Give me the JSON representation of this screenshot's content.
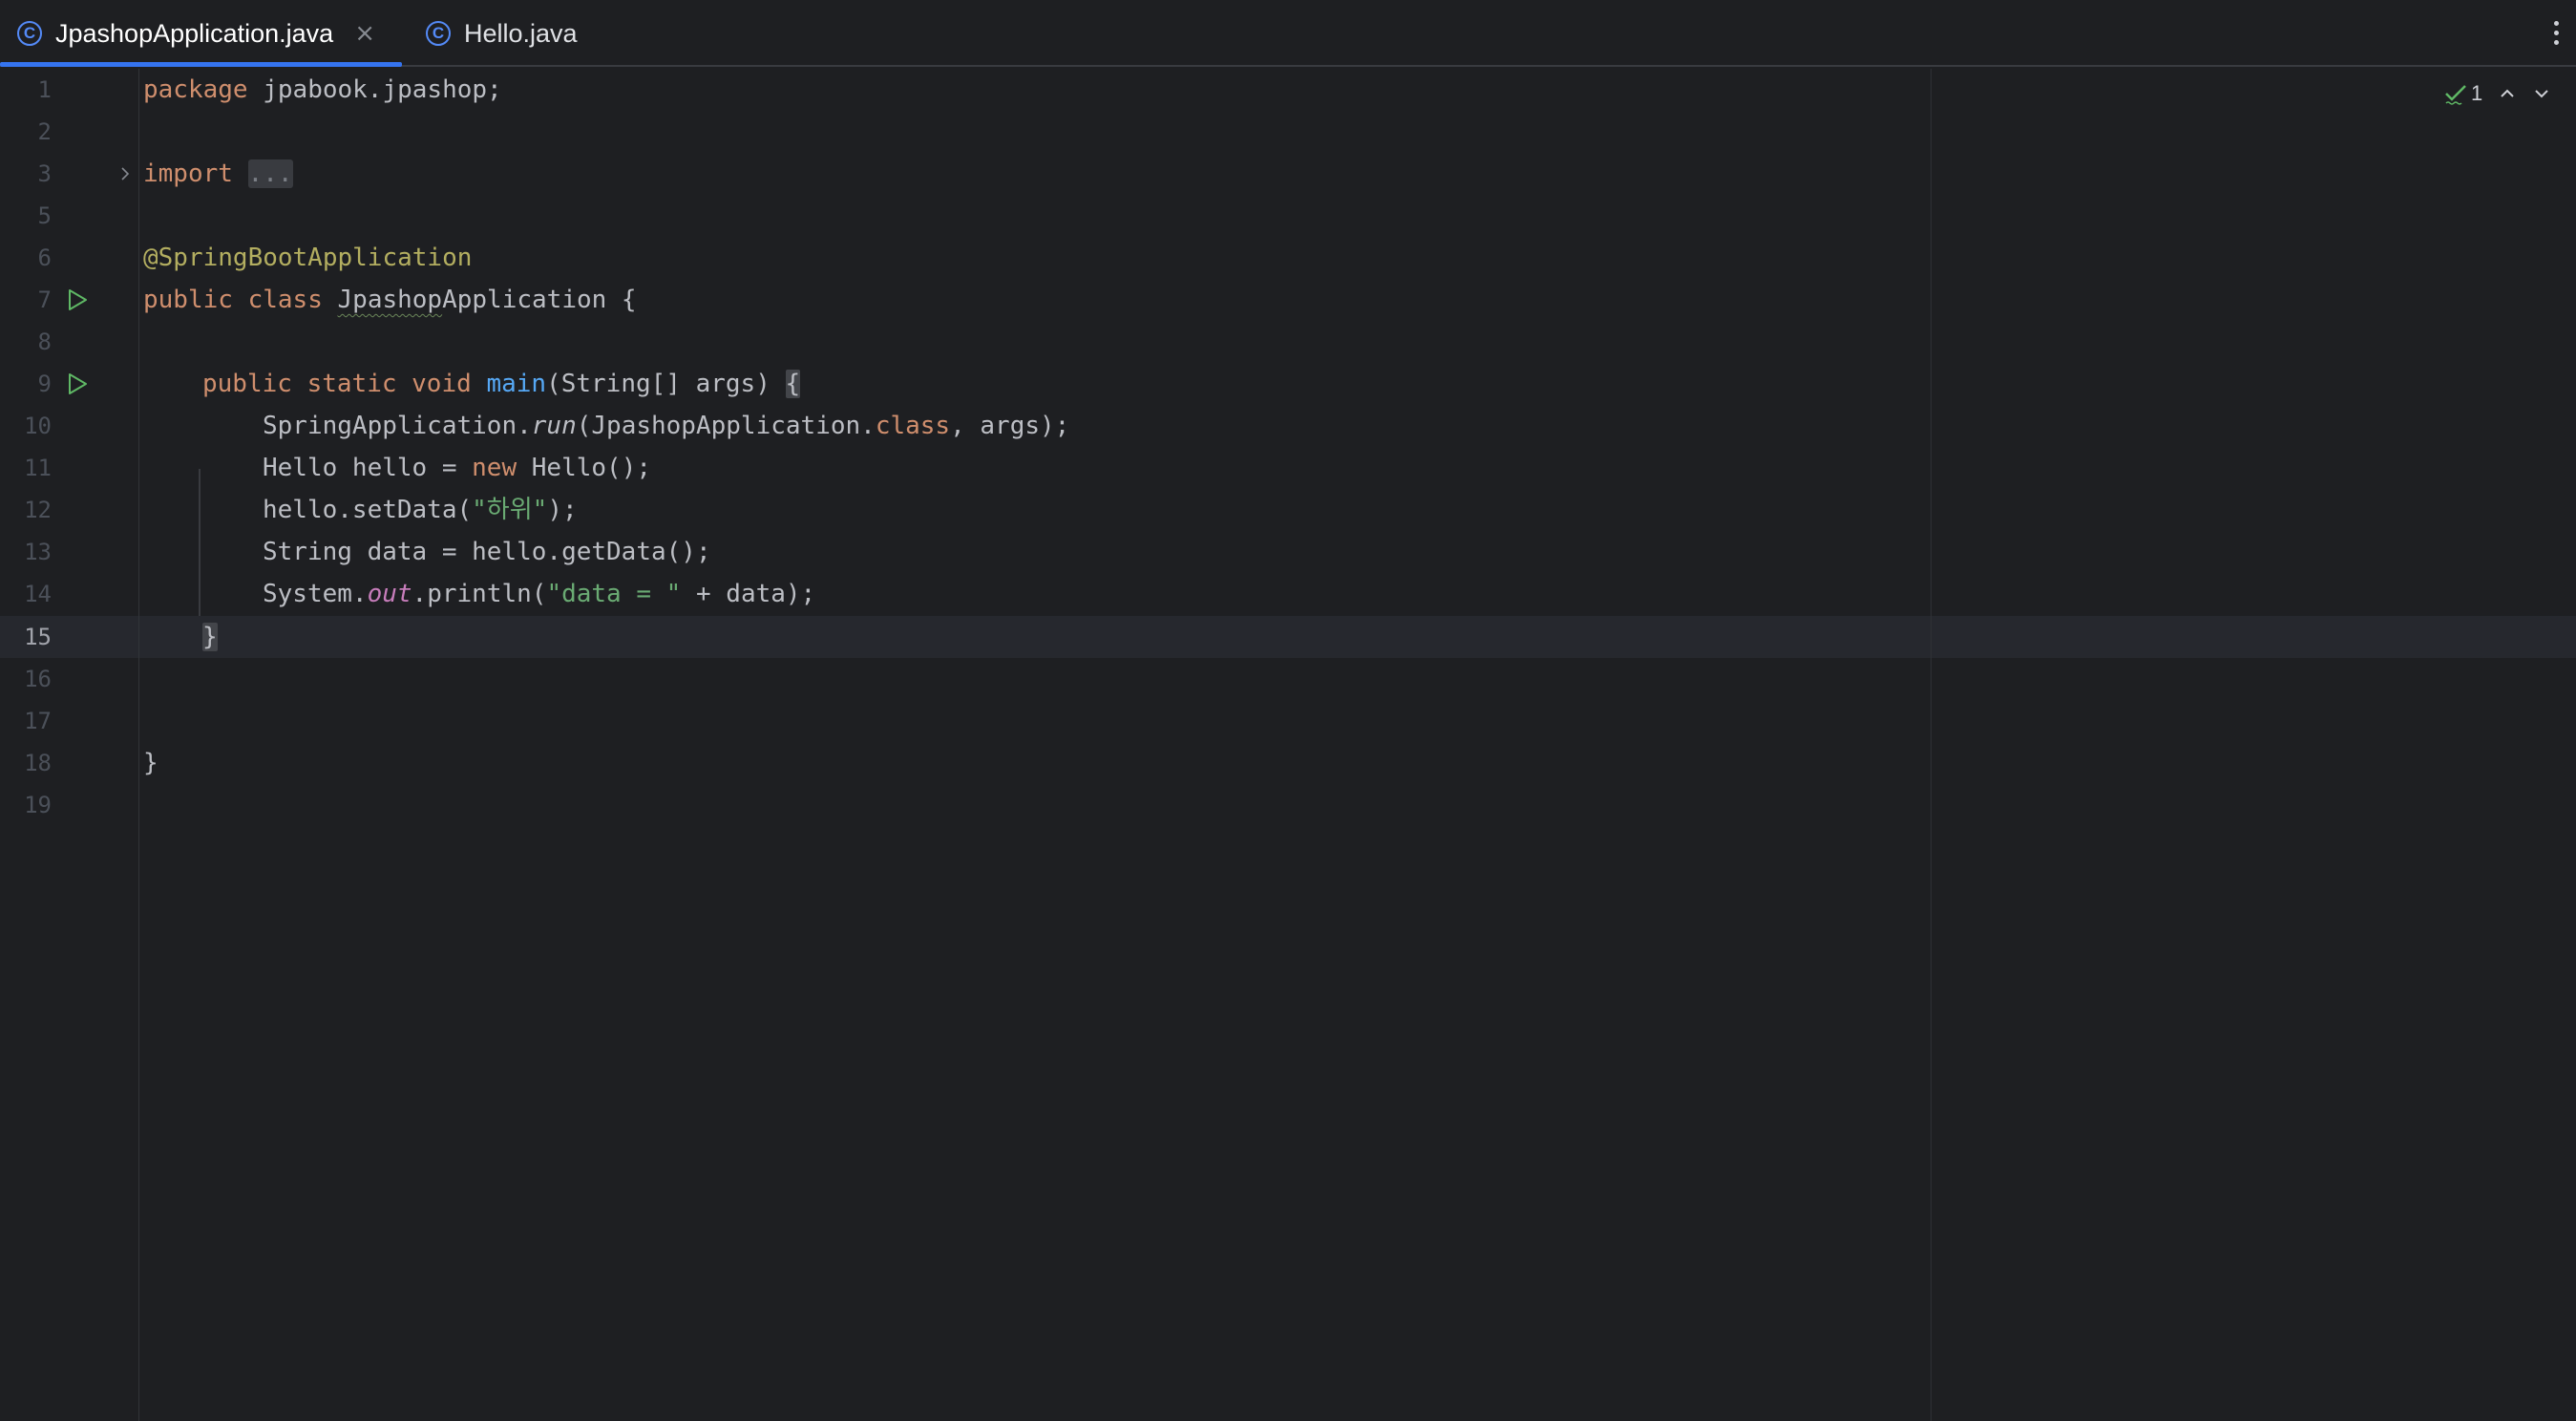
{
  "tabs": [
    {
      "label": "JpashopApplication.java",
      "icon": "class-icon",
      "active": true,
      "close": "×"
    },
    {
      "label": "Hello.java",
      "icon": "class-icon",
      "active": false
    }
  ],
  "class_icon_letter": "C",
  "inspections": {
    "count": "1"
  },
  "lines": {
    "n1": "1",
    "n2": "2",
    "n3": "3",
    "n5": "5",
    "n6": "6",
    "n7": "7",
    "n8": "8",
    "n9": "9",
    "n10": "10",
    "n11": "11",
    "n12": "12",
    "n13": "13",
    "n14": "14",
    "n15": "15",
    "n16": "16",
    "n17": "17",
    "n18": "18",
    "n19": "19"
  },
  "code": {
    "l1_kw": "package",
    "l1_rest": " jpabook.jpashop;",
    "l3_kw": "import",
    "l3_fold": "...",
    "l6_ann": "@SpringBootApplication",
    "l7_kw1": "public",
    "l7_kw2": "class",
    "l7_cls_a": "Jpashop",
    "l7_cls_b": "Application",
    "l7_rest": " {",
    "l9_kw1": "public",
    "l9_kw2": "static",
    "l9_kw3": "void",
    "l9_fn": "main",
    "l9_rest": "(String[] args) ",
    "l9_brace": "{",
    "l10_a": "SpringApplication.",
    "l10_run": "run",
    "l10_b": "(JpashopApplication.",
    "l10_kw": "class",
    "l10_c": ", args);",
    "l11_a": "Hello hello = ",
    "l11_kw": "new",
    "l11_b": " Hello();",
    "l12_a": "hello.setData(",
    "l12_str": "\"하위\"",
    "l12_b": ");",
    "l13": "String data = hello.getData();",
    "l14_a": "System.",
    "l14_out": "out",
    "l14_b": ".println(",
    "l14_str": "\"data = \"",
    "l14_c": " + data);",
    "l15_brace": "}",
    "l18": "}"
  },
  "colors": {
    "keyword": "#cf8e6d",
    "annotation": "#b3ae60",
    "function": "#56a8f5",
    "string": "#6aab73",
    "static_field": "#c77dbb",
    "accent": "#3574f0"
  }
}
